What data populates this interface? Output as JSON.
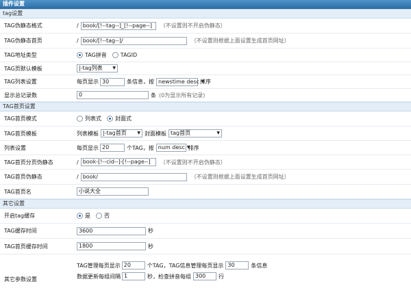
{
  "header": {
    "title": "插件设置"
  },
  "sections": {
    "tag": "tag设置",
    "index": "TAG首页设置",
    "other": "其它设置"
  },
  "rows": {
    "pseudo_format": {
      "label": "TAG伪静态格式",
      "prefix": "/",
      "value": "book/[!--tag--]_[!--page--]",
      "hint": "（不设置则不开启伪静态）"
    },
    "pseudo_first": {
      "label": "TAG伪静态首页",
      "prefix": "/",
      "value": "book/[!--tag--]/",
      "hint": "（不设置则根据上面设置生成首页网址）"
    },
    "addr_type": {
      "label": "TAG地址类型",
      "opt1": "TAG拼音",
      "opt2": "TAGID"
    },
    "default_tpl": {
      "label": "TAG页默认模板",
      "value": "|-tag列表"
    },
    "list_setting": {
      "label": "TAG列表设置",
      "pre": "每页显示",
      "count": "30",
      "mid": "条信息，按",
      "order": "newstime desc",
      "post": "排序"
    },
    "total": {
      "label": "显示总记录数",
      "value": "0",
      "unit": "条",
      "hint": "(0为显示所有记录)"
    },
    "index_mode": {
      "label": "TAG首页模式",
      "opt1": "列表式",
      "opt2": "封面式"
    },
    "index_tpl": {
      "label": "TAG首页模板",
      "list_label": "列表模板",
      "list_value": "|-tag首页",
      "cover_label": "封面模板",
      "cover_value": "tag首页"
    },
    "list_cfg": {
      "label": "列表设置",
      "pre": "每页显示",
      "count": "20",
      "mid": "个TAG，按",
      "order": "num desc",
      "post": "排序"
    },
    "page_pseudo": {
      "label": "TAG首页分页伪静态",
      "prefix": "/",
      "value": "book-[!--cid--]-[!--page--]",
      "hint": "（不设置则不开启伪静态）"
    },
    "index_pseudo": {
      "label": "TAG首页伪静态",
      "prefix": "/",
      "value": "book/",
      "hint": "（不设置则根据上面设置生成首页网址）"
    },
    "index_name": {
      "label": "TAG首页名",
      "value": "小说大全"
    },
    "cache_on": {
      "label": "开启tag缓存",
      "opt1": "是",
      "opt2": "否"
    },
    "cache_time": {
      "label": "TAG缓存时间",
      "value": "3600",
      "unit": "秒"
    },
    "index_cache": {
      "label": "TAG首页缓存时间",
      "value": "1800",
      "unit": "秒"
    },
    "other_params": {
      "label": "其它参数设置",
      "l1_pre": "TAG管理每页显示",
      "l1_a": "20",
      "l1_mid": "个TAG，TAG信息管理每页显示",
      "l1_b": "30",
      "l1_post": "条信息",
      "l2_pre": "数据更新每组间隔",
      "l2_a": "1",
      "l2_mid": "秒，检查拼音每组",
      "l2_b": "300",
      "l2_post": "行"
    }
  },
  "colors": {
    "header": "#3a7db8",
    "section": "#e3eef8",
    "radio_on": "#2a62a8"
  }
}
